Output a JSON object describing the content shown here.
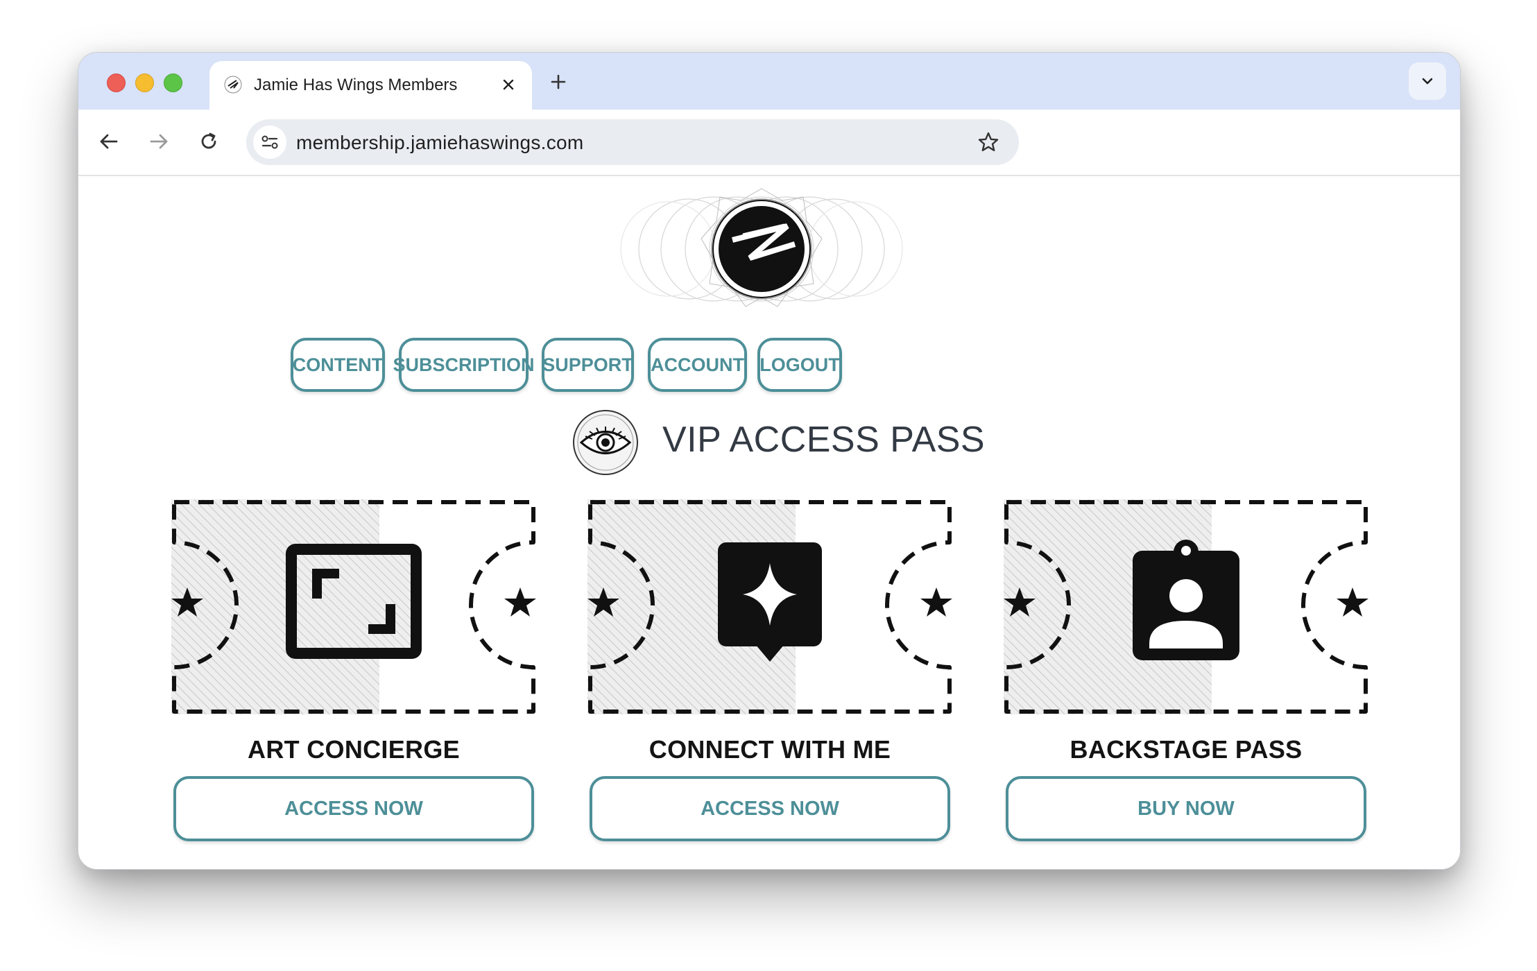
{
  "browser": {
    "tab_title": "Jamie Has Wings Members",
    "url": "membership.jamiehaswings.com"
  },
  "nav": {
    "items": [
      {
        "label": "CONTENT"
      },
      {
        "label": "SUBSCRIPTION"
      },
      {
        "label": "SUPPORT"
      },
      {
        "label": "ACCOUNT"
      },
      {
        "label": "LOGOUT"
      }
    ]
  },
  "section": {
    "title": "VIP ACCESS PASS"
  },
  "passes": [
    {
      "label": "ART CONCIERGE",
      "button": "ACCESS NOW",
      "icon": "frame-icon"
    },
    {
      "label": "CONNECT WITH ME",
      "button": "ACCESS NOW",
      "icon": "sparkle-chat-icon"
    },
    {
      "label": "BACKSTAGE PASS",
      "button": "BUY NOW",
      "icon": "badge-person-icon"
    }
  ],
  "colors": {
    "accent": "#4d8f98",
    "tabbar": "#d8e2f8"
  }
}
